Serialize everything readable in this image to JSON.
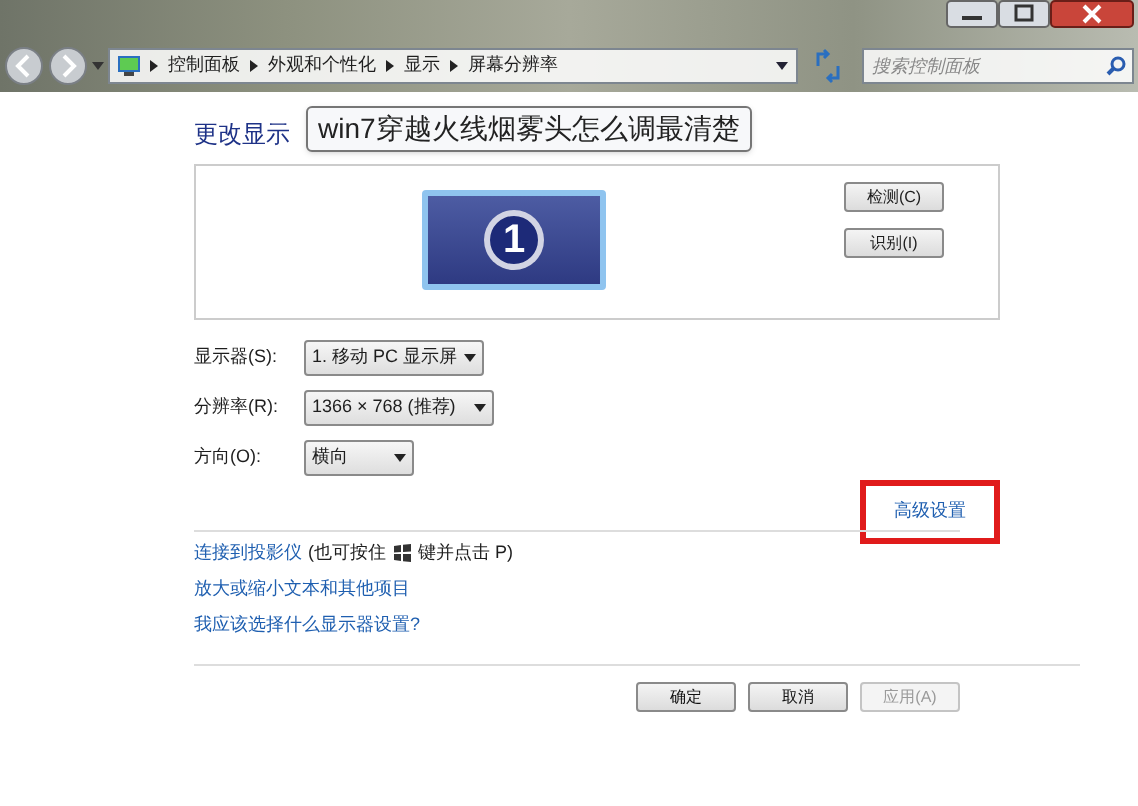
{
  "address_bar": {
    "breadcrumbs": [
      "控制面板",
      "外观和个性化",
      "显示",
      "屏幕分辨率"
    ],
    "search": {
      "placeholder": "搜索控制面板"
    }
  },
  "heading": "更改显示",
  "tooltip": "win7穿越火线烟雾头怎么调最清楚",
  "monitor_panel": {
    "monitor_number": "1",
    "buttons": [
      "检测(C)",
      "识别(I)"
    ]
  },
  "settings": [
    {
      "label": "显示器(S):",
      "value": "1. 移动 PC 显示屏"
    },
    {
      "label": "分辨率(R):",
      "value": "1366 × 768 (推荐)"
    },
    {
      "label": "方向(O):",
      "value": "横向"
    }
  ],
  "advanced_link": {
    "label": "高级设置",
    "highlighted": true
  },
  "links": [
    {
      "kind": "projector",
      "label": "连接到投影仪",
      "note_before": "(也可按住",
      "note_after": "键并点击 P)"
    },
    {
      "kind": "plain",
      "label": "放大或缩小文本和其他项目"
    },
    {
      "kind": "plain",
      "label": "我应该选择什么显示器设置?"
    }
  ],
  "dialog_buttons": [
    {
      "label": "确定",
      "disabled": false
    },
    {
      "label": "取消",
      "disabled": false
    },
    {
      "label": "应用(A)",
      "disabled": true
    }
  ]
}
